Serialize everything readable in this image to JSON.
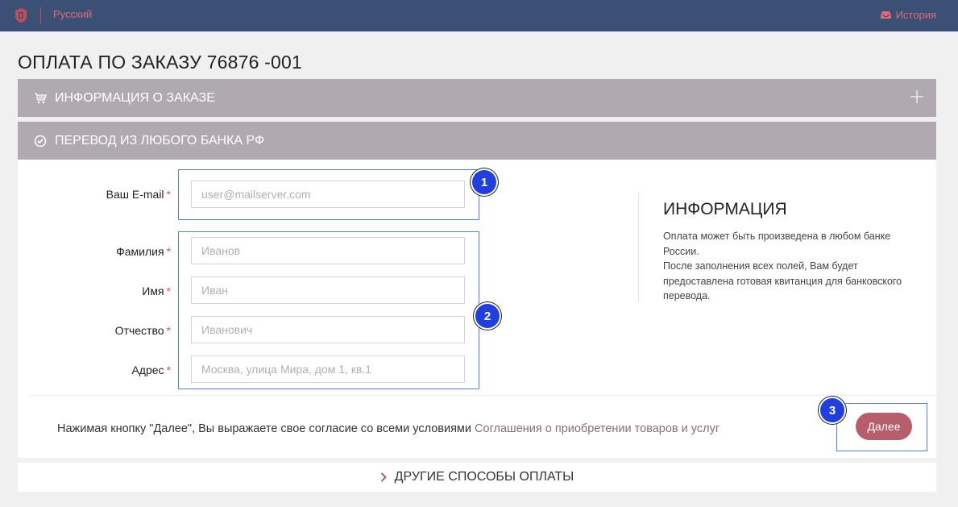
{
  "topbar": {
    "language": "Русский",
    "history": "История",
    "logo_icon": "shield-logo-icon",
    "history_icon": "inbox-icon",
    "accent": "#e06a76",
    "bg": "#3a5074"
  },
  "page": {
    "title": "ОПЛАТА ПО ЗАКАЗУ 76876 -001"
  },
  "panels": {
    "order_info": "ИНФОРМАЦИЯ О ЗАКАЗЕ",
    "bank_transfer": "ПЕРЕВОД ИЗ ЛЮБОГО БАНКА РФ",
    "header_color": "#b0aab0"
  },
  "form": {
    "email": {
      "label": "Ваш E-mail",
      "placeholder": "user@mailserver.com",
      "value": ""
    },
    "surname": {
      "label": "Фамилия",
      "placeholder": "Иванов",
      "value": ""
    },
    "name": {
      "label": "Имя",
      "placeholder": "Иван",
      "value": ""
    },
    "patronymic": {
      "label": "Отчество",
      "placeholder": "Иванович",
      "value": ""
    },
    "address": {
      "label": "Адрес",
      "placeholder": "Москва, улица Мира, дом 1, кв.1",
      "value": ""
    },
    "required_mark": "*"
  },
  "info": {
    "title": "ИНФОРМАЦИЯ",
    "line1": "Оплата может быть произведена в любом банке России.",
    "line2": "После заполнения всех полей, Вам будет предоставлена готовая квитанция для банковского перевода."
  },
  "consent": {
    "text": "Нажимая кнопку \"Далее\", Вы выражаете свое согласие со всеми условиями",
    "link": "Соглашения о приобретении товаров и услуг"
  },
  "buttons": {
    "next": "Далее",
    "next_color": "#b85d6c"
  },
  "other_methods": "ДРУГИЕ СПОСОБЫ ОПЛАТЫ",
  "markers": [
    "1",
    "2",
    "3"
  ]
}
